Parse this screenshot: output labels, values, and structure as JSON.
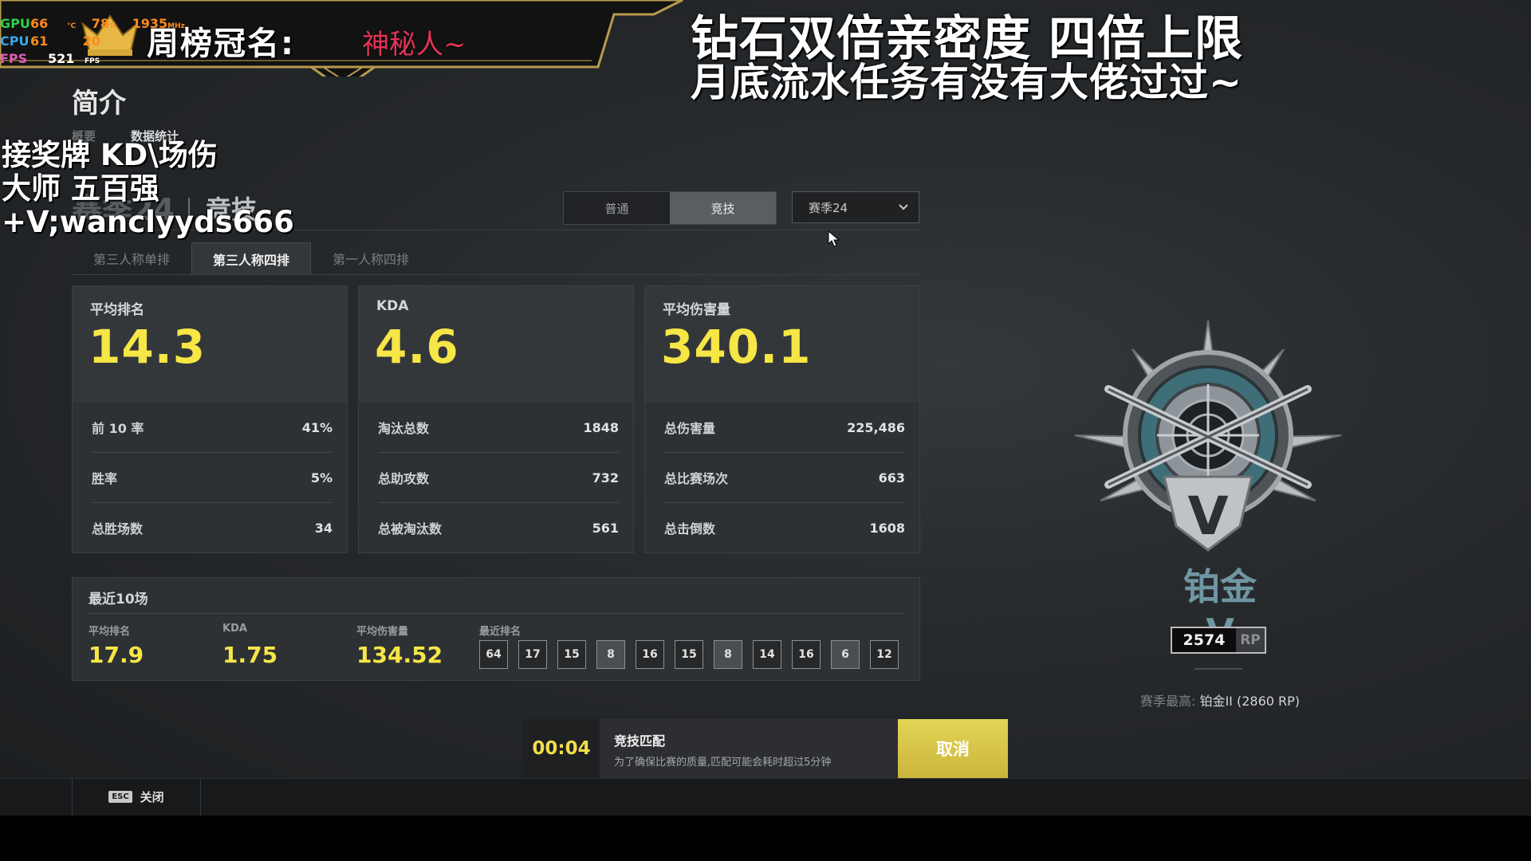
{
  "overlay": {
    "hw": [
      {
        "label": "GPU",
        "v1": "66",
        "u1": "°C",
        "v2": "78",
        "u2": "%",
        "v3": "1935",
        "u3": "MHz",
        "color": "#2bd14a"
      },
      {
        "label": "CPU",
        "v1": "61",
        "u1": "",
        "v2": "20",
        "u2": "",
        "v3": "",
        "u3": "",
        "color": "#3aa7e8"
      },
      {
        "label": "FPS",
        "v1": "521",
        "u1": "FPS",
        "v2": "",
        "u2": "",
        "v3": "",
        "u3": "",
        "color": "#e05ab8"
      }
    ],
    "champion_label": "周榜冠名:",
    "champion_name": "神秘人~",
    "announcement_line1": "钻石双倍亲密度 四倍上限",
    "announcement_line2": "月底流水任务有没有大佬过过~",
    "left_ad_lines": [
      "接奖牌 KD\\场伤",
      "大师 五百强",
      "+V;wanclyyds666"
    ]
  },
  "page": {
    "title": "简介",
    "subtabs": [
      "概要",
      "数据统计"
    ],
    "season_heading": "赛季24",
    "mode_heading": "竞技"
  },
  "mode_toggle": {
    "options": [
      "普通",
      "竞技"
    ],
    "active": "竞技"
  },
  "season_select": {
    "value": "赛季24"
  },
  "queue_tabs": [
    "第三人称单排",
    "第三人称四排",
    "第一人称四排"
  ],
  "active_queue_tab": "第三人称四排",
  "cards": [
    {
      "label": "平均排名",
      "value": "14.3",
      "rows": [
        {
          "label": "前 10 率",
          "value": "41%"
        },
        {
          "label": "胜率",
          "value": "5%"
        },
        {
          "label": "总胜场数",
          "value": "34"
        }
      ]
    },
    {
      "label": "KDA",
      "value": "4.6",
      "rows": [
        {
          "label": "淘汰总数",
          "value": "1848"
        },
        {
          "label": "总助攻数",
          "value": "732"
        },
        {
          "label": "总被淘汰数",
          "value": "561"
        }
      ]
    },
    {
      "label": "平均伤害量",
      "value": "340.1",
      "rows": [
        {
          "label": "总伤害量",
          "value": "225,486"
        },
        {
          "label": "总比赛场次",
          "value": "663"
        },
        {
          "label": "总击倒数",
          "value": "1608"
        }
      ]
    }
  ],
  "recent": {
    "title": "最近10场",
    "stats": [
      {
        "label": "平均排名",
        "value": "17.9"
      },
      {
        "label": "KDA",
        "value": "1.75"
      },
      {
        "label": "平均伤害量",
        "value": "134.52"
      }
    ],
    "ranks_label": "最近排名",
    "ranks": [
      "64",
      "17",
      "15",
      "8",
      "16",
      "15",
      "8",
      "14",
      "16",
      "6",
      "12"
    ],
    "highlighted_ranks": [
      "8",
      "8",
      "6"
    ]
  },
  "rank": {
    "tier_name": "铂金 V",
    "tier_numeral": "V",
    "rp_value": "2574",
    "rp_unit": "RP",
    "season_best_label": "赛季最高:",
    "season_best_value": "铂金II (2860 RP)"
  },
  "matchmaking": {
    "timer": "00:04",
    "title": "竞技匹配",
    "subtitle": "为了确保比赛的质量,匹配可能会耗时超过5分钟",
    "cancel_label": "取消"
  },
  "footer": {
    "esc_key": "ESC",
    "close_label": "关闭"
  },
  "colors": {
    "accent_yellow": "#f6e646",
    "tier_color": "#6f97a3",
    "cancel_button": "#d8c64a",
    "champion_name": "#e23456"
  },
  "icons": [
    "cursor-icon",
    "chevron-down-icon",
    "crown-icon",
    "rank-badge-icon",
    "esc-key-icon"
  ]
}
